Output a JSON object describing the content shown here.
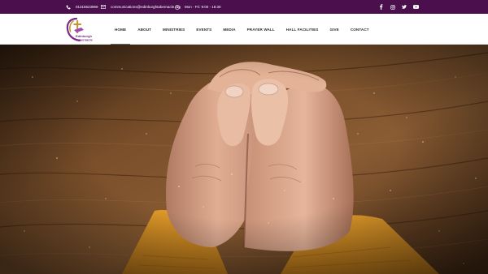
{
  "topbar": {
    "phone": "01315523969",
    "email": "communications@edinburghtabernacle.org",
    "hours": "Mon - Fri: 9:00 - 18:30",
    "social": [
      "facebook-icon",
      "instagram-icon",
      "twitter-icon",
      "youtube-icon"
    ]
  },
  "logo": {
    "lines": [
      "Edinburgh",
      "Tabernacle"
    ]
  },
  "nav": {
    "items": [
      "HOME",
      "ABOUT",
      "MINISTRIES",
      "EVENTS",
      "MEDIA",
      "PRAYER WALL",
      "HALL FACILITIES",
      "GIVE",
      "CONTACT"
    ],
    "active": "HOME"
  },
  "hero": {
    "image": "praying-hands-photo"
  },
  "colors": {
    "topbar_bg": "#4b0f4e",
    "logo_accent": "#7a2a86",
    "logo_gold": "#c4922e"
  }
}
